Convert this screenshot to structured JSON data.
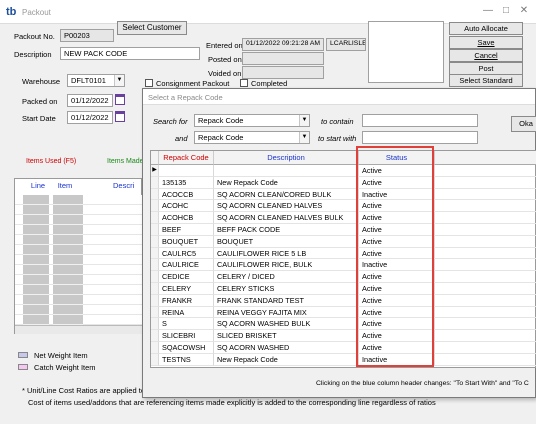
{
  "window": {
    "title": "Packout"
  },
  "packout": {
    "packout_no_label": "Packout No.",
    "packout_no": "P00203",
    "select_customer_label": "Select Customer",
    "description_label": "Description",
    "description": "NEW PACK CODE",
    "entered_on_label": "Entered on",
    "entered_on": "01/12/2022 09:21:28 AM",
    "entered_by": "LCARLISLE",
    "posted_on_label": "Posted on",
    "voided_on_label": "Voided on",
    "warehouse_label": "Warehouse",
    "warehouse": "DFLT0101",
    "packed_on_label": "Packed on",
    "packed_on": "01/12/2022",
    "start_date_label": "Start Date",
    "start_date": "01/12/2022",
    "consignment_label": "Consignment Packout",
    "completed_label": "Completed"
  },
  "side_buttons": {
    "auto_allocate": "Auto Allocate",
    "save": "Save",
    "cancel": "Cancel",
    "post": "Post",
    "select_standard": "Select Standard"
  },
  "tabs": {
    "items_used": "Items Used (F5)",
    "items_made": "Items Made"
  },
  "left_grid": {
    "col_line": "Line",
    "col_item": "Item",
    "col_desc": "Descri"
  },
  "legend": {
    "net_weight": "Net Weight Item",
    "catch_weight": "Catch Weight Item"
  },
  "footnotes": {
    "line1": "* Unit/Line Cost Ratios are applied to t",
    "line2": "Cost of items used/addons that are referencing items made explicitly is added to the corresponding line regardless of ratios"
  },
  "dialog": {
    "title": "Select a Repack Code",
    "search_for_label": "Search for",
    "search_field": "Repack Code",
    "to_contain_label": "to contain",
    "and_label": "and",
    "and_field": "Repack Code",
    "to_start_with_label": "to start with",
    "ok_label": "Oka",
    "col_code": "Repack Code",
    "col_desc": "Description",
    "col_status": "Status",
    "hint": "Clicking on the blue column header changes:  \"To Start With\" and \"To C",
    "colors": {
      "code_header": "#cc0000",
      "desc_header": "#1a33cc",
      "status_header": "#1a33cc",
      "highlight": "#e0403a"
    }
  },
  "rows": [
    {
      "code": "",
      "desc": "",
      "status": "Active",
      "current": true
    },
    {
      "code": "135135",
      "desc": "New Repack Code",
      "status": "Active"
    },
    {
      "code": "ACOCCB",
      "desc": "SQ ACORN CLEAN/CORED BULK",
      "status": "Inactive"
    },
    {
      "code": "ACOHC",
      "desc": "SQ ACORN CLEANED HALVES",
      "status": "Active"
    },
    {
      "code": "ACOHCB",
      "desc": "SQ ACORN CLEANED HALVES BULK",
      "status": "Active"
    },
    {
      "code": "BEEF",
      "desc": "BEFF PACK CODE",
      "status": "Active"
    },
    {
      "code": "BOUQUET",
      "desc": "BOUQUET",
      "status": "Active"
    },
    {
      "code": "CAULRC5",
      "desc": "CAULIFLOWER RICE 5 LB",
      "status": "Active"
    },
    {
      "code": "CAULRICE",
      "desc": "CAULIFLOWER RICE, BULK",
      "status": "Inactive"
    },
    {
      "code": "CEDICE",
      "desc": "CELERY / DICED",
      "status": "Active"
    },
    {
      "code": "CELERY",
      "desc": "CELERY STICKS",
      "status": "Active"
    },
    {
      "code": "FRANKR",
      "desc": "FRANK STANDARD TEST",
      "status": "Active"
    },
    {
      "code": "REINA",
      "desc": "REINA VEGGY FAJITA MIX",
      "status": "Active"
    },
    {
      "code": "S",
      "desc": "SQ ACORN WASHED BULK",
      "status": "Active"
    },
    {
      "code": "SLICEBRI",
      "desc": "SLICED BRISKET",
      "status": "Active"
    },
    {
      "code": "SQACOWSH",
      "desc": "SQ ACORN WASHED",
      "status": "Active"
    },
    {
      "code": "TESTNS",
      "desc": "New Repack Code",
      "status": "Inactive"
    }
  ]
}
